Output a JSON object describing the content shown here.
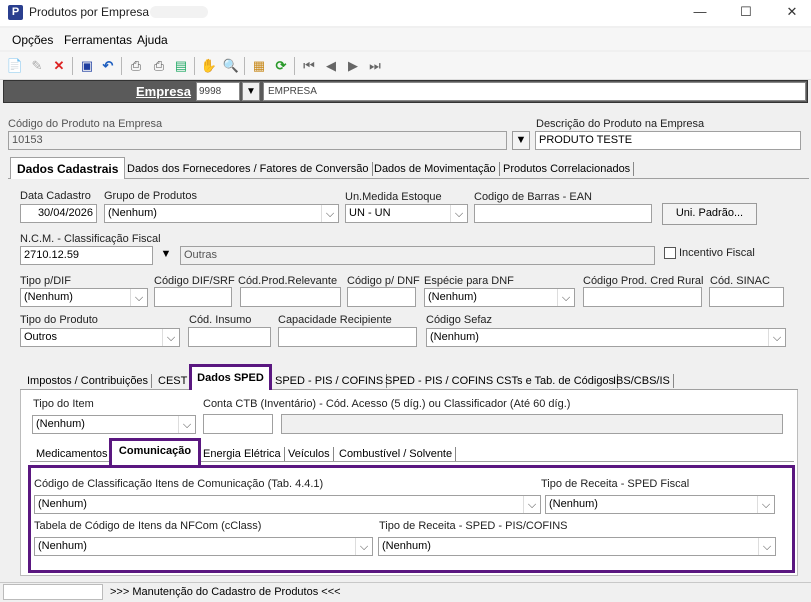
{
  "window": {
    "title": "Produtos por Empresa",
    "minimize": "—",
    "maximize": "☐",
    "close": "✕"
  },
  "menu": [
    "Opções",
    "Ferramentas",
    "Ajuda"
  ],
  "empresa": {
    "label": "Empresa",
    "code": "9998",
    "name": "EMPRESA"
  },
  "top_fields": {
    "codigo_label": "Código do Produto na Empresa",
    "codigo_value": "10153",
    "descricao_label": "Descrição do Produto na Empresa",
    "descricao_value": "PRODUTO TESTE"
  },
  "main_tabs": [
    "Dados Cadastrais",
    "Dados dos Fornecedores / Fatores de Conversão",
    "Dados de Movimentação",
    "Produtos Correlacionados"
  ],
  "cadastro": {
    "data_cadastro_label": "Data Cadastro",
    "data_cadastro_value": "30/04/2026",
    "grupo_label": "Grupo de Produtos",
    "grupo_value": "(Nenhum)",
    "unmedida_label": "Un.Medida Estoque",
    "unmedida_value": "UN - UN",
    "ean_label": "Codigo de Barras - EAN",
    "ean_value": "",
    "uni_padrao_button": "Uni. Padrão...",
    "ncm_label": "N.C.M. - Classificação Fiscal",
    "ncm_value": "2710.12.59",
    "ncm_desc": "Outras",
    "incentivo_label": "Incentivo Fiscal",
    "tipo_dif_label": "Tipo p/DIF",
    "tipo_dif_value": "(Nenhum)",
    "cod_dif_label": "Código DIF/SRF",
    "cod_relevante_label": "Cód.Prod.Relevante",
    "cod_dnf_label": "Código p/ DNF",
    "especie_dnf_label": "Espécie para DNF",
    "especie_dnf_value": "(Nenhum)",
    "cred_rural_label": "Código Prod. Cred Rural",
    "sinac_label": "Cód. SINAC",
    "tipo_produto_label": "Tipo do Produto",
    "tipo_produto_value": "Outros",
    "cod_insumo_label": "Cód. Insumo",
    "capacidade_label": "Capacidade Recipiente",
    "cod_sefaz_label": "Código Sefaz",
    "cod_sefaz_value": "(Nenhum)"
  },
  "sub_tabs": [
    "Impostos / Contribuições",
    "CEST",
    "Dados SPED",
    "SPED - PIS / COFINS",
    "SPED - PIS / COFINS CSTs e Tab. de Códigos",
    "IBS/CBS/IS"
  ],
  "sped": {
    "tipo_item_label": "Tipo do Item",
    "tipo_item_value": "(Nenhum)",
    "conta_ctb_label": "Conta CTB (Inventário) - Cód. Acesso (5 díg.) ou Classificador (Até 60 díg.)"
  },
  "sped_tabs": [
    "Medicamentos",
    "Comunicação",
    "Energia Elétrica",
    "Veículos",
    "Combustível / Solvente"
  ],
  "comunicacao": {
    "classif_label": "Código de Classificação Itens de Comunicação (Tab. 4.4.1)",
    "classif_value": "(Nenhum)",
    "receita_fiscal_label": "Tipo de Receita - SPED Fiscal",
    "receita_fiscal_value": "(Nenhum)",
    "nfcom_label": "Tabela de Código de Itens da NFCom (cClass)",
    "nfcom_value": "(Nenhum)",
    "receita_pis_label": "Tipo de Receita - SPED - PIS/COFINS",
    "receita_pis_value": "(Nenhum)"
  },
  "status": {
    "text": ">>> Manutenção do Cadastro de Produtos <<<"
  },
  "colors": {
    "highlight": "#5a1780",
    "empresa_bar": "#5a5a5a"
  }
}
